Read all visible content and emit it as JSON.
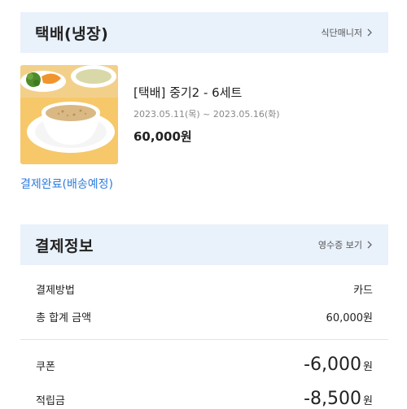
{
  "shipping": {
    "title": "택배(냉장)",
    "link_label": "식단매니저"
  },
  "product": {
    "name": "[택배] 중기2 - 6세트",
    "date_range": "2023.05.11(목) ~ 2023.05.16(화)",
    "price": "60,000원",
    "image": "baby-food-porridge-bowl"
  },
  "order_status": "결제완료(배송예정)",
  "payment": {
    "title": "결제정보",
    "link_label": "영수증 보기",
    "method_label": "결제방법",
    "method_value": "카드",
    "total_label": "총 합계 금액",
    "total_value": "60,000원",
    "coupon_label": "쿠폰",
    "coupon_amount": "-6,000",
    "coupon_unit": "원",
    "points_label": "적립금",
    "points_amount": "-8,500",
    "points_unit": "원"
  },
  "colors": {
    "header_bg": "#e9f1fb",
    "accent_blue": "#2d7de0"
  }
}
